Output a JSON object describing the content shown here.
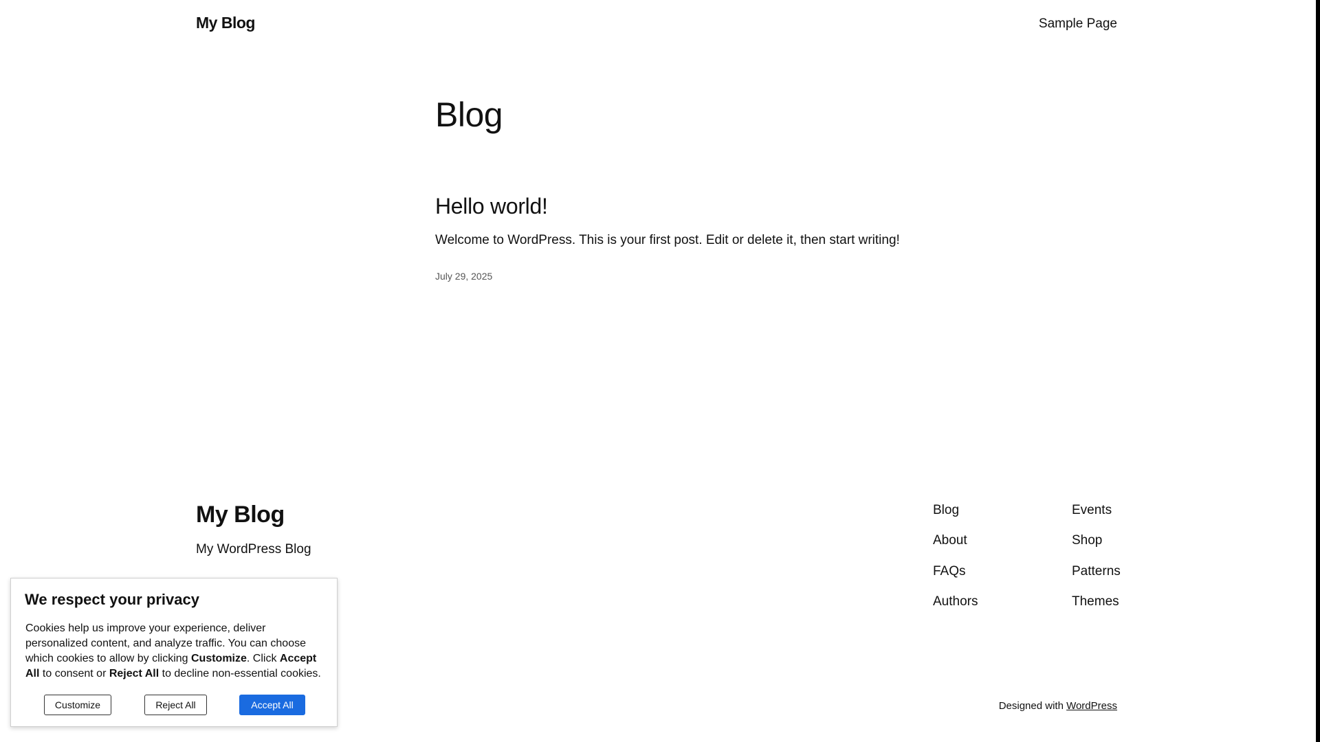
{
  "header": {
    "site_title": "My Blog",
    "nav": [
      "Sample Page"
    ]
  },
  "main": {
    "page_title": "Blog",
    "posts": [
      {
        "title": "Hello world!",
        "excerpt": "Welcome to WordPress. This is your first post. Edit or delete it, then start writing!",
        "date": "July 29, 2025"
      }
    ]
  },
  "footer": {
    "site_title": "My Blog",
    "tagline": "My WordPress Blog",
    "links_col1": [
      "Blog",
      "About",
      "FAQs",
      "Authors"
    ],
    "links_col2": [
      "Events",
      "Shop",
      "Patterns",
      "Themes"
    ],
    "credit_prefix": "Designed with",
    "credit_link": "WordPress"
  },
  "cookie_banner": {
    "title": "We respect your privacy",
    "text_1": "Cookies help us improve your experience, deliver personalized content, and analyze traffic. You can choose which cookies to allow by clicking ",
    "text_customize": "Customize",
    "text_2": ". Click ",
    "text_accept": "Accept All",
    "text_3": " to consent or ",
    "text_reject": "Reject All",
    "text_4": " to decline non-essential cookies.",
    "buttons": {
      "customize": "Customize",
      "reject": "Reject All",
      "accept": "Accept All"
    },
    "accent_color": "#1a6be0"
  }
}
